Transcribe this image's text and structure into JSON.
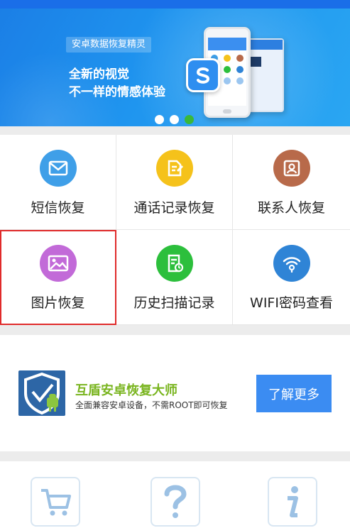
{
  "banner": {
    "tag": "安卓数据恢复精灵",
    "line1": "全新的视觉",
    "line2": "不一样的情感体验",
    "carousel_active_index": 2,
    "carousel_count": 3
  },
  "features": [
    {
      "label": "短信恢复",
      "icon": "message-icon",
      "color": "#3f9fe8"
    },
    {
      "label": "通话记录恢复",
      "icon": "call-log-icon",
      "color": "#f5c21b"
    },
    {
      "label": "联系人恢复",
      "icon": "contact-icon",
      "color": "#b86a4a"
    },
    {
      "label": "图片恢复",
      "icon": "photo-icon",
      "color": "#c26ad8"
    },
    {
      "label": "历史扫描记录",
      "icon": "history-icon",
      "color": "#2cbf3c"
    },
    {
      "label": "WIFI密码查看",
      "icon": "wifi-icon",
      "color": "#2f84d6"
    }
  ],
  "promo": {
    "title": "互盾安卓恢复大师",
    "description": "全面兼容安卓设备，不需ROOT即可恢复",
    "button_label": "了解更多"
  },
  "bottom_icons": [
    "cart-icon",
    "help-icon",
    "info-icon"
  ],
  "colors": {
    "accent": "#3b8cf2",
    "highlight": "#e02a2a",
    "promo_title": "#7ab520"
  }
}
